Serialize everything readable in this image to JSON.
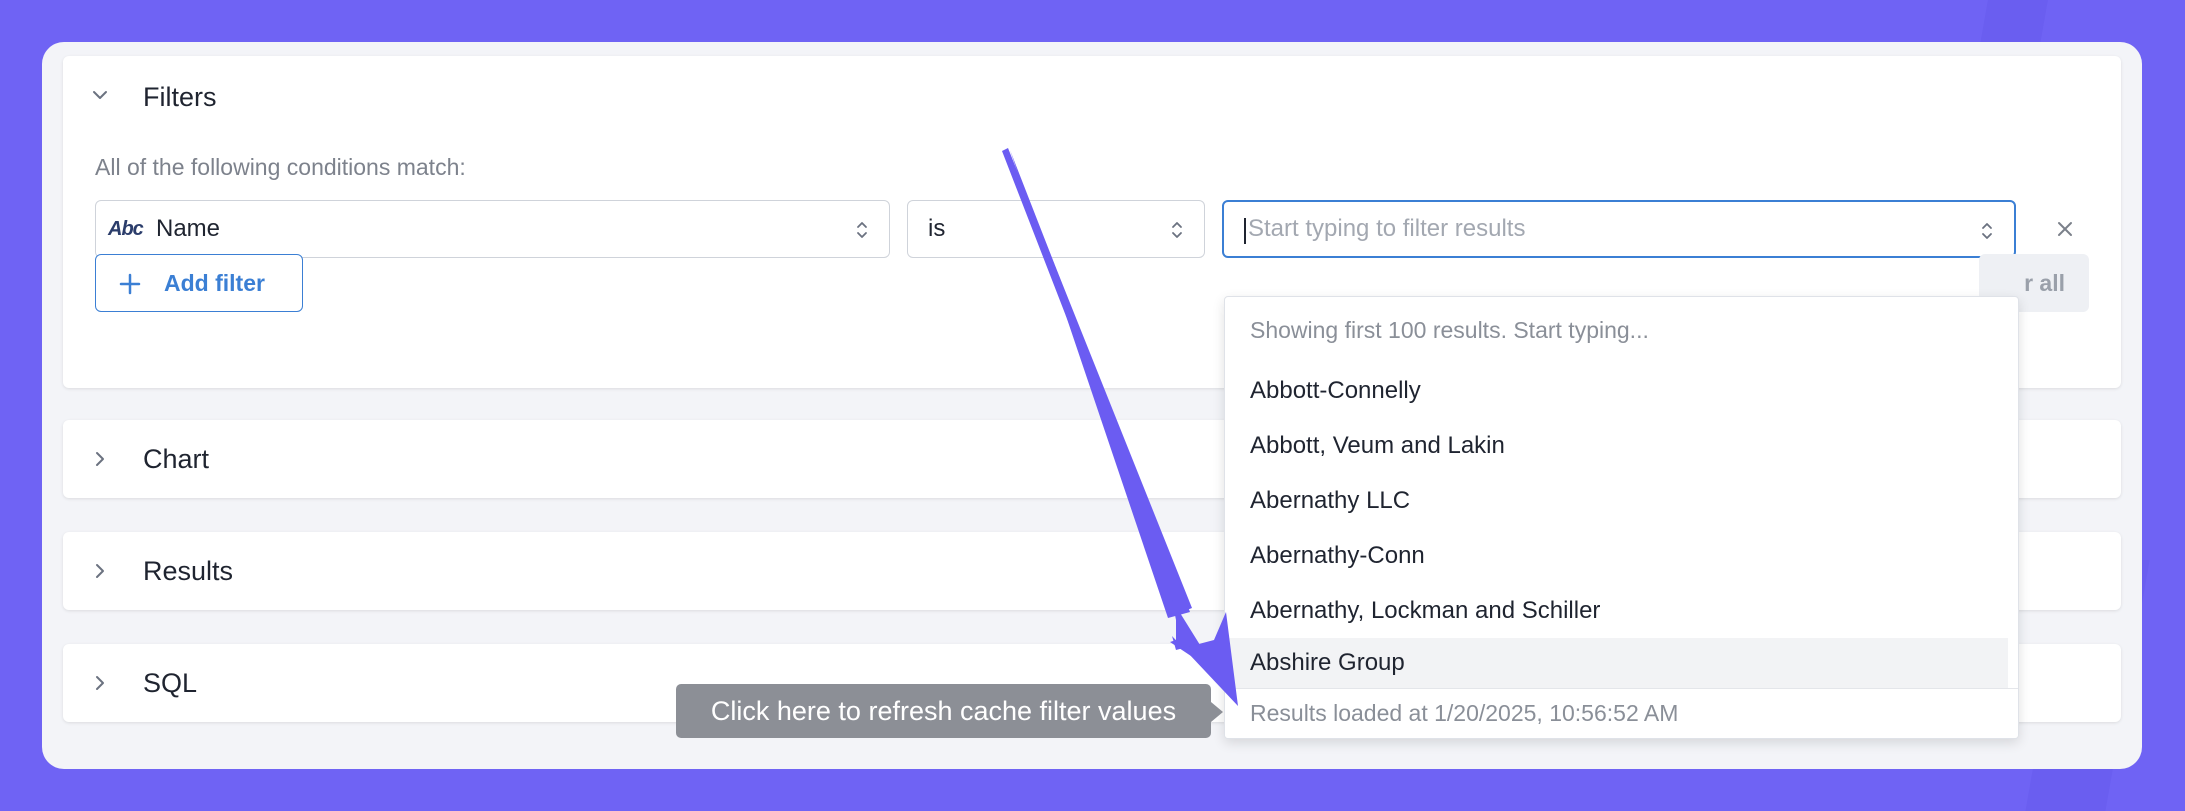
{
  "colors": {
    "background": "#6f63f4",
    "accent": "#3b7fd4",
    "arrow": "#6b5cf2"
  },
  "filters": {
    "title": "Filters",
    "conditions_text": "All of the following conditions match:",
    "field_type_icon": "Abc",
    "field_value": "Name",
    "operator_value": "is",
    "value_placeholder": "Start typing to filter results",
    "add_filter_label": "Add filter",
    "clear_all_label": "r all"
  },
  "sections": [
    {
      "title": "Chart"
    },
    {
      "title": "Results"
    },
    {
      "title": "SQL"
    }
  ],
  "dropdown": {
    "header": "Showing first 100 results. Start typing...",
    "items": [
      "Abbott-Connelly",
      "Abbott, Veum and Lakin",
      "Abernathy LLC",
      "Abernathy-Conn",
      "Abernathy, Lockman and Schiller",
      "Abshire Group"
    ],
    "footer": "Results loaded at 1/20/2025, 10:56:52 AM"
  },
  "tooltip": {
    "text": "Click here to refresh cache filter values"
  },
  "icons": [
    "chevron-down-icon",
    "chevron-right-icon",
    "updown-icon",
    "plus-icon",
    "close-icon",
    "annotation-arrow"
  ]
}
